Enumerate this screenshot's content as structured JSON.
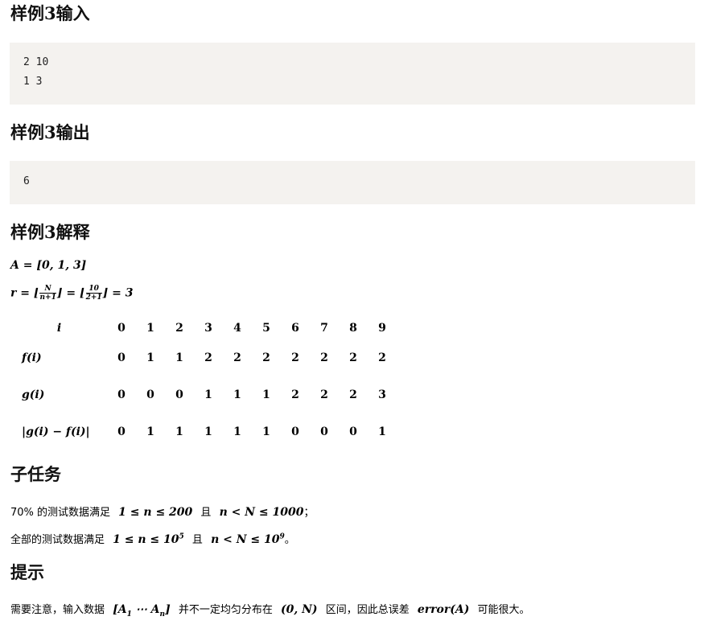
{
  "sections": {
    "input_title": "样例3输入",
    "output_title": "样例3输出",
    "explain_title": "样例3解释",
    "subtask_title": "子任务",
    "hint_title": "提示"
  },
  "sample_input": {
    "line1": "2 10",
    "line2": "1 3"
  },
  "sample_output": {
    "line1": "6"
  },
  "explain": {
    "a_line": "A = [0, 1, 3]",
    "r_lhs": "r = ⌊",
    "r_frac1_num": "N",
    "r_frac1_den": "n+1",
    "r_mid": "⌋ = ⌊",
    "r_frac2_num": "10",
    "r_frac2_den": "2+1",
    "r_end": "⌋ = 3"
  },
  "table": {
    "header_label": "i",
    "header": [
      "0",
      "1",
      "2",
      "3",
      "4",
      "5",
      "6",
      "7",
      "8",
      "9"
    ],
    "rows": [
      {
        "label": "f(i)",
        "values": [
          "0",
          "1",
          "1",
          "2",
          "2",
          "2",
          "2",
          "2",
          "2",
          "2"
        ]
      },
      {
        "label": "g(i)",
        "values": [
          "0",
          "0",
          "0",
          "1",
          "1",
          "1",
          "2",
          "2",
          "2",
          "3"
        ]
      },
      {
        "label": "|g(i) − f(i)|",
        "values": [
          "0",
          "1",
          "1",
          "1",
          "1",
          "1",
          "0",
          "0",
          "0",
          "1"
        ]
      }
    ]
  },
  "subtask": {
    "line1_pre": "70% 的测试数据满足",
    "line1_math1": "1 ≤ n ≤ 200",
    "line1_and": "且",
    "line1_math2": "n < N ≤ 1000",
    "line1_end": "；",
    "line2_pre": "全部的测试数据满足",
    "line2_math1a": "1 ≤ n ≤ 10",
    "line2_exp1": "5",
    "line2_and": "且",
    "line2_math2a": "n < N ≤ 10",
    "line2_exp2": "9",
    "line2_end": "。"
  },
  "hint": {
    "pre": "需要注意，输入数据",
    "math1a": "[A",
    "math1sub1": "1",
    "math1b": " ⋯ A",
    "math1sub2": "n",
    "math1c": "]",
    "mid1": "并不一定均匀分布在",
    "math2": "(0, N)",
    "mid2": "区间，因此总误差",
    "math3": "error(A)",
    "end": "可能很大。"
  }
}
